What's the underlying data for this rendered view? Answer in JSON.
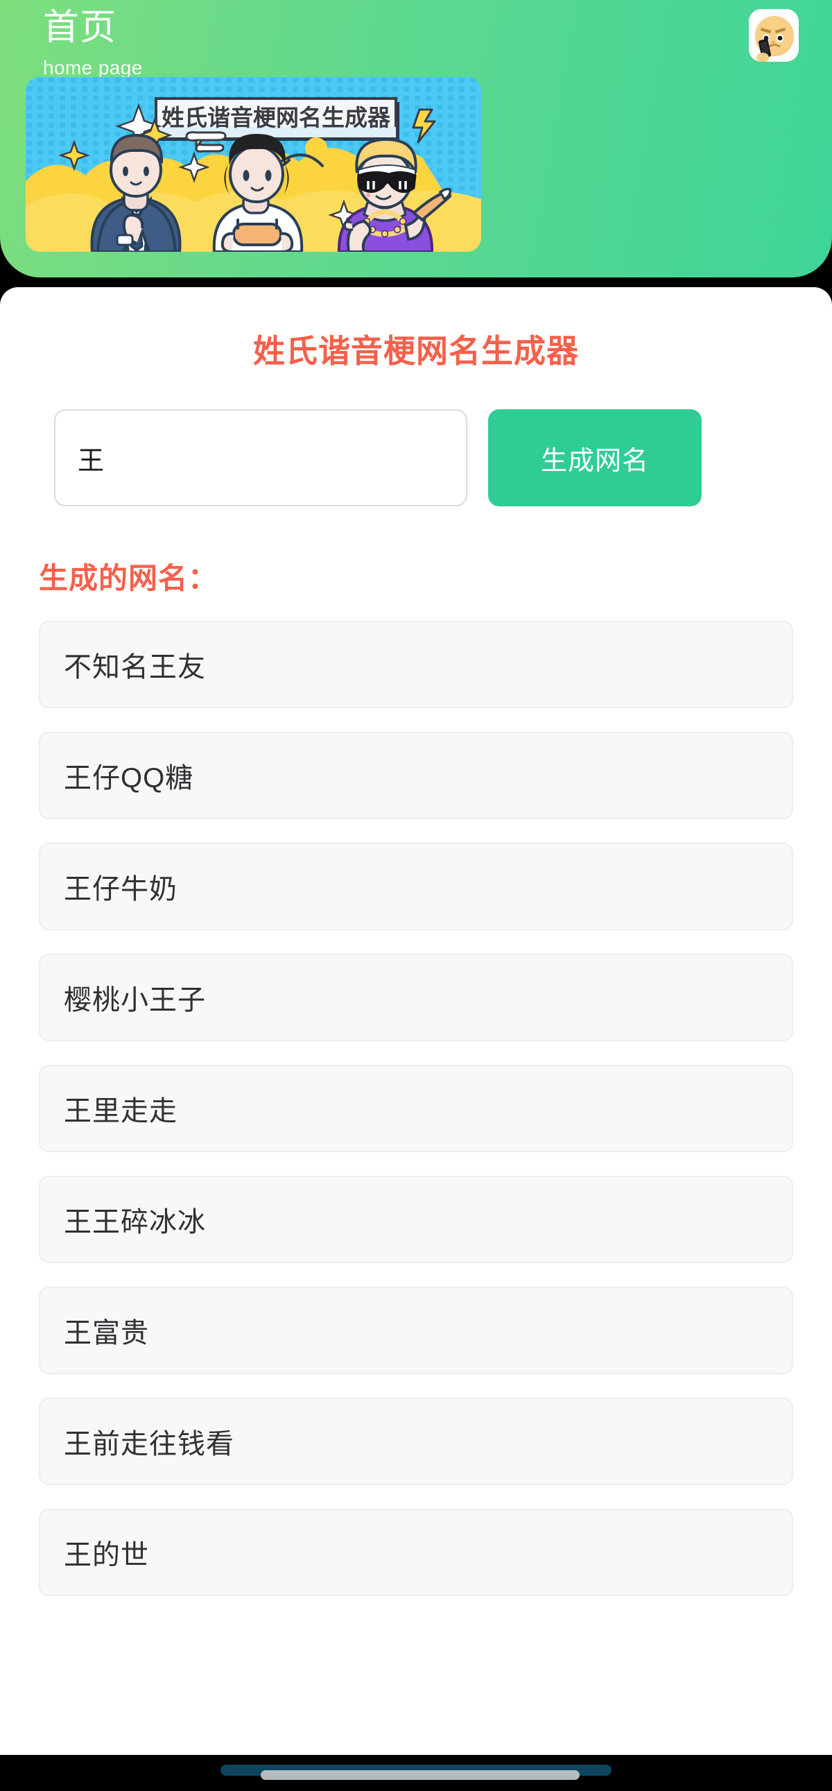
{
  "statusbar": {
    "time": "",
    "center": "",
    "right": ""
  },
  "header": {
    "title": "首页",
    "subtitle": "home page",
    "avatar_icon": "angry-face-avatar",
    "background_color": "#4fd68f"
  },
  "banner": {
    "headline": "姓氏谐音梗网名生成器",
    "background_color": "#45c4f0",
    "accent_color": "#fcd846"
  },
  "main": {
    "title": "姓氏谐音梗网名生成器",
    "title_color": "#f5604a",
    "input": {
      "value": "王",
      "placeholder": "请输入姓氏"
    },
    "generate_button": {
      "label": "生成网名",
      "color": "#2fcd94"
    },
    "results_label": "生成的网名：",
    "results": [
      "不知名王友",
      "王仔QQ糖",
      "王仔牛奶",
      "樱桃小王子",
      "王里走走",
      "王王碎冰冰",
      "王富贵",
      "王前走往钱看",
      "王的世"
    ]
  }
}
